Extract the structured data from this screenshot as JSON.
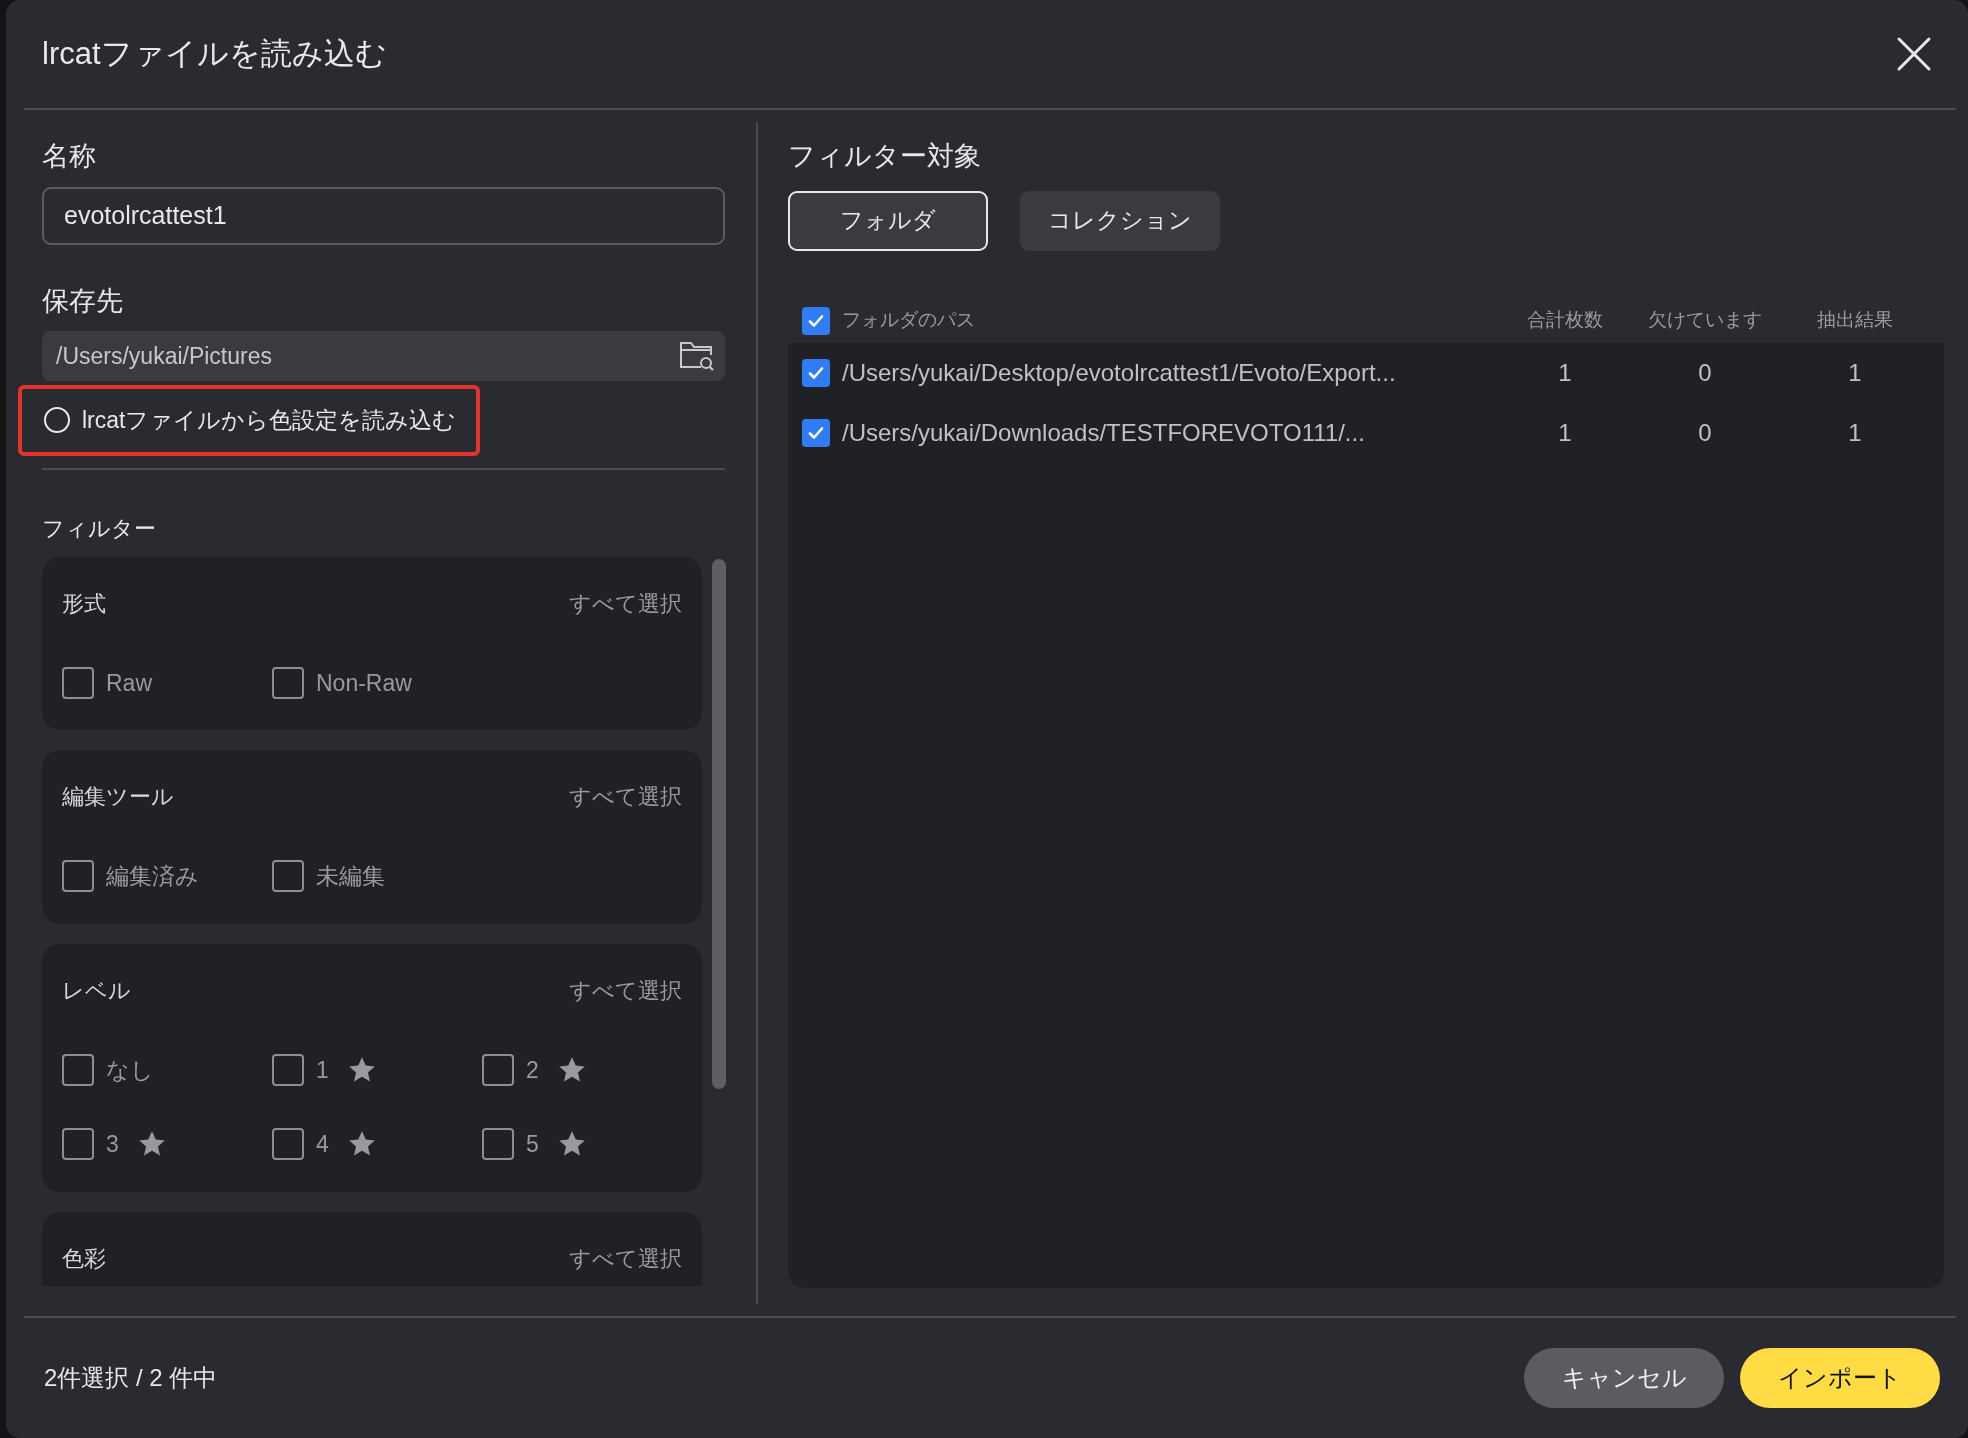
{
  "dialog": {
    "title": "lrcatファイルを読み込む"
  },
  "name": {
    "label": "名称",
    "value": "evotolrcattest1"
  },
  "destination": {
    "label": "保存先",
    "value": "/Users/yukai/Pictures"
  },
  "color_option": {
    "label": "lrcatファイルから色設定を読み込む",
    "selected": false,
    "highlighted": true
  },
  "filters": {
    "label": "フィルター",
    "groups": [
      {
        "title": "形式",
        "select_all": "すべて選択",
        "options": [
          {
            "label": "Raw",
            "checked": false,
            "star": false
          },
          {
            "label": "Non-Raw",
            "checked": false,
            "star": false
          }
        ]
      },
      {
        "title": "編集ツール",
        "select_all": "すべて選択",
        "options": [
          {
            "label": "編集済み",
            "checked": false,
            "star": false
          },
          {
            "label": "未編集",
            "checked": false,
            "star": false
          }
        ]
      },
      {
        "title": "レベル",
        "select_all": "すべて選択",
        "options": [
          {
            "label": "なし",
            "checked": false,
            "star": false
          },
          {
            "label": "1",
            "checked": false,
            "star": true
          },
          {
            "label": "2",
            "checked": false,
            "star": true
          },
          {
            "label": "3",
            "checked": false,
            "star": true
          },
          {
            "label": "4",
            "checked": false,
            "star": true
          },
          {
            "label": "5",
            "checked": false,
            "star": true
          }
        ]
      },
      {
        "title": "色彩",
        "select_all": "すべて選択"
      }
    ]
  },
  "target": {
    "label": "フィルター対象",
    "tabs": [
      {
        "label": "フォルダ",
        "selected": true
      },
      {
        "label": "コレクション",
        "selected": false
      }
    ],
    "table": {
      "select_all_checked": true,
      "columns": [
        "フォルダのパス",
        "合計枚数",
        "欠けています",
        "抽出結果"
      ],
      "rows": [
        {
          "checked": true,
          "path": "/Users/yukai/Desktop/evotolrcattest1/Evoto/Export...",
          "total": "1",
          "missing": "0",
          "result": "1"
        },
        {
          "checked": true,
          "path": "/Users/yukai/Downloads/TESTFOREVOTO111/...",
          "total": "1",
          "missing": "0",
          "result": "1"
        }
      ]
    }
  },
  "footer": {
    "summary": "2件選択 / 2 件中",
    "buttons": [
      {
        "label": "キャンセル",
        "kind": "secondary"
      },
      {
        "label": "インポート",
        "kind": "primary"
      }
    ]
  }
}
